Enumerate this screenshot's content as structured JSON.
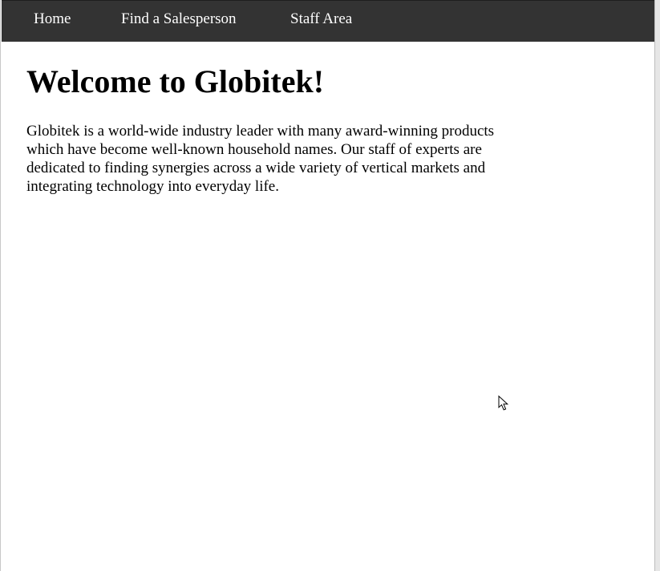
{
  "nav": {
    "items": [
      {
        "label": "Home"
      },
      {
        "label": "Find a Salesperson"
      },
      {
        "label": "Staff Area"
      }
    ]
  },
  "main": {
    "title": "Welcome to Globitek!",
    "intro": "Globitek is a world-wide industry leader with many award-winning products which have become well-known household names. Our staff of experts are dedicated to finding synergies across a wide variety of vertical markets and integrating technology into everyday life."
  },
  "colors": {
    "navbar_bg": "#333333",
    "nav_text": "#ffffff",
    "page_bg": "#ffffff"
  },
  "icons": {
    "cursor": "mouse-pointer-icon"
  }
}
